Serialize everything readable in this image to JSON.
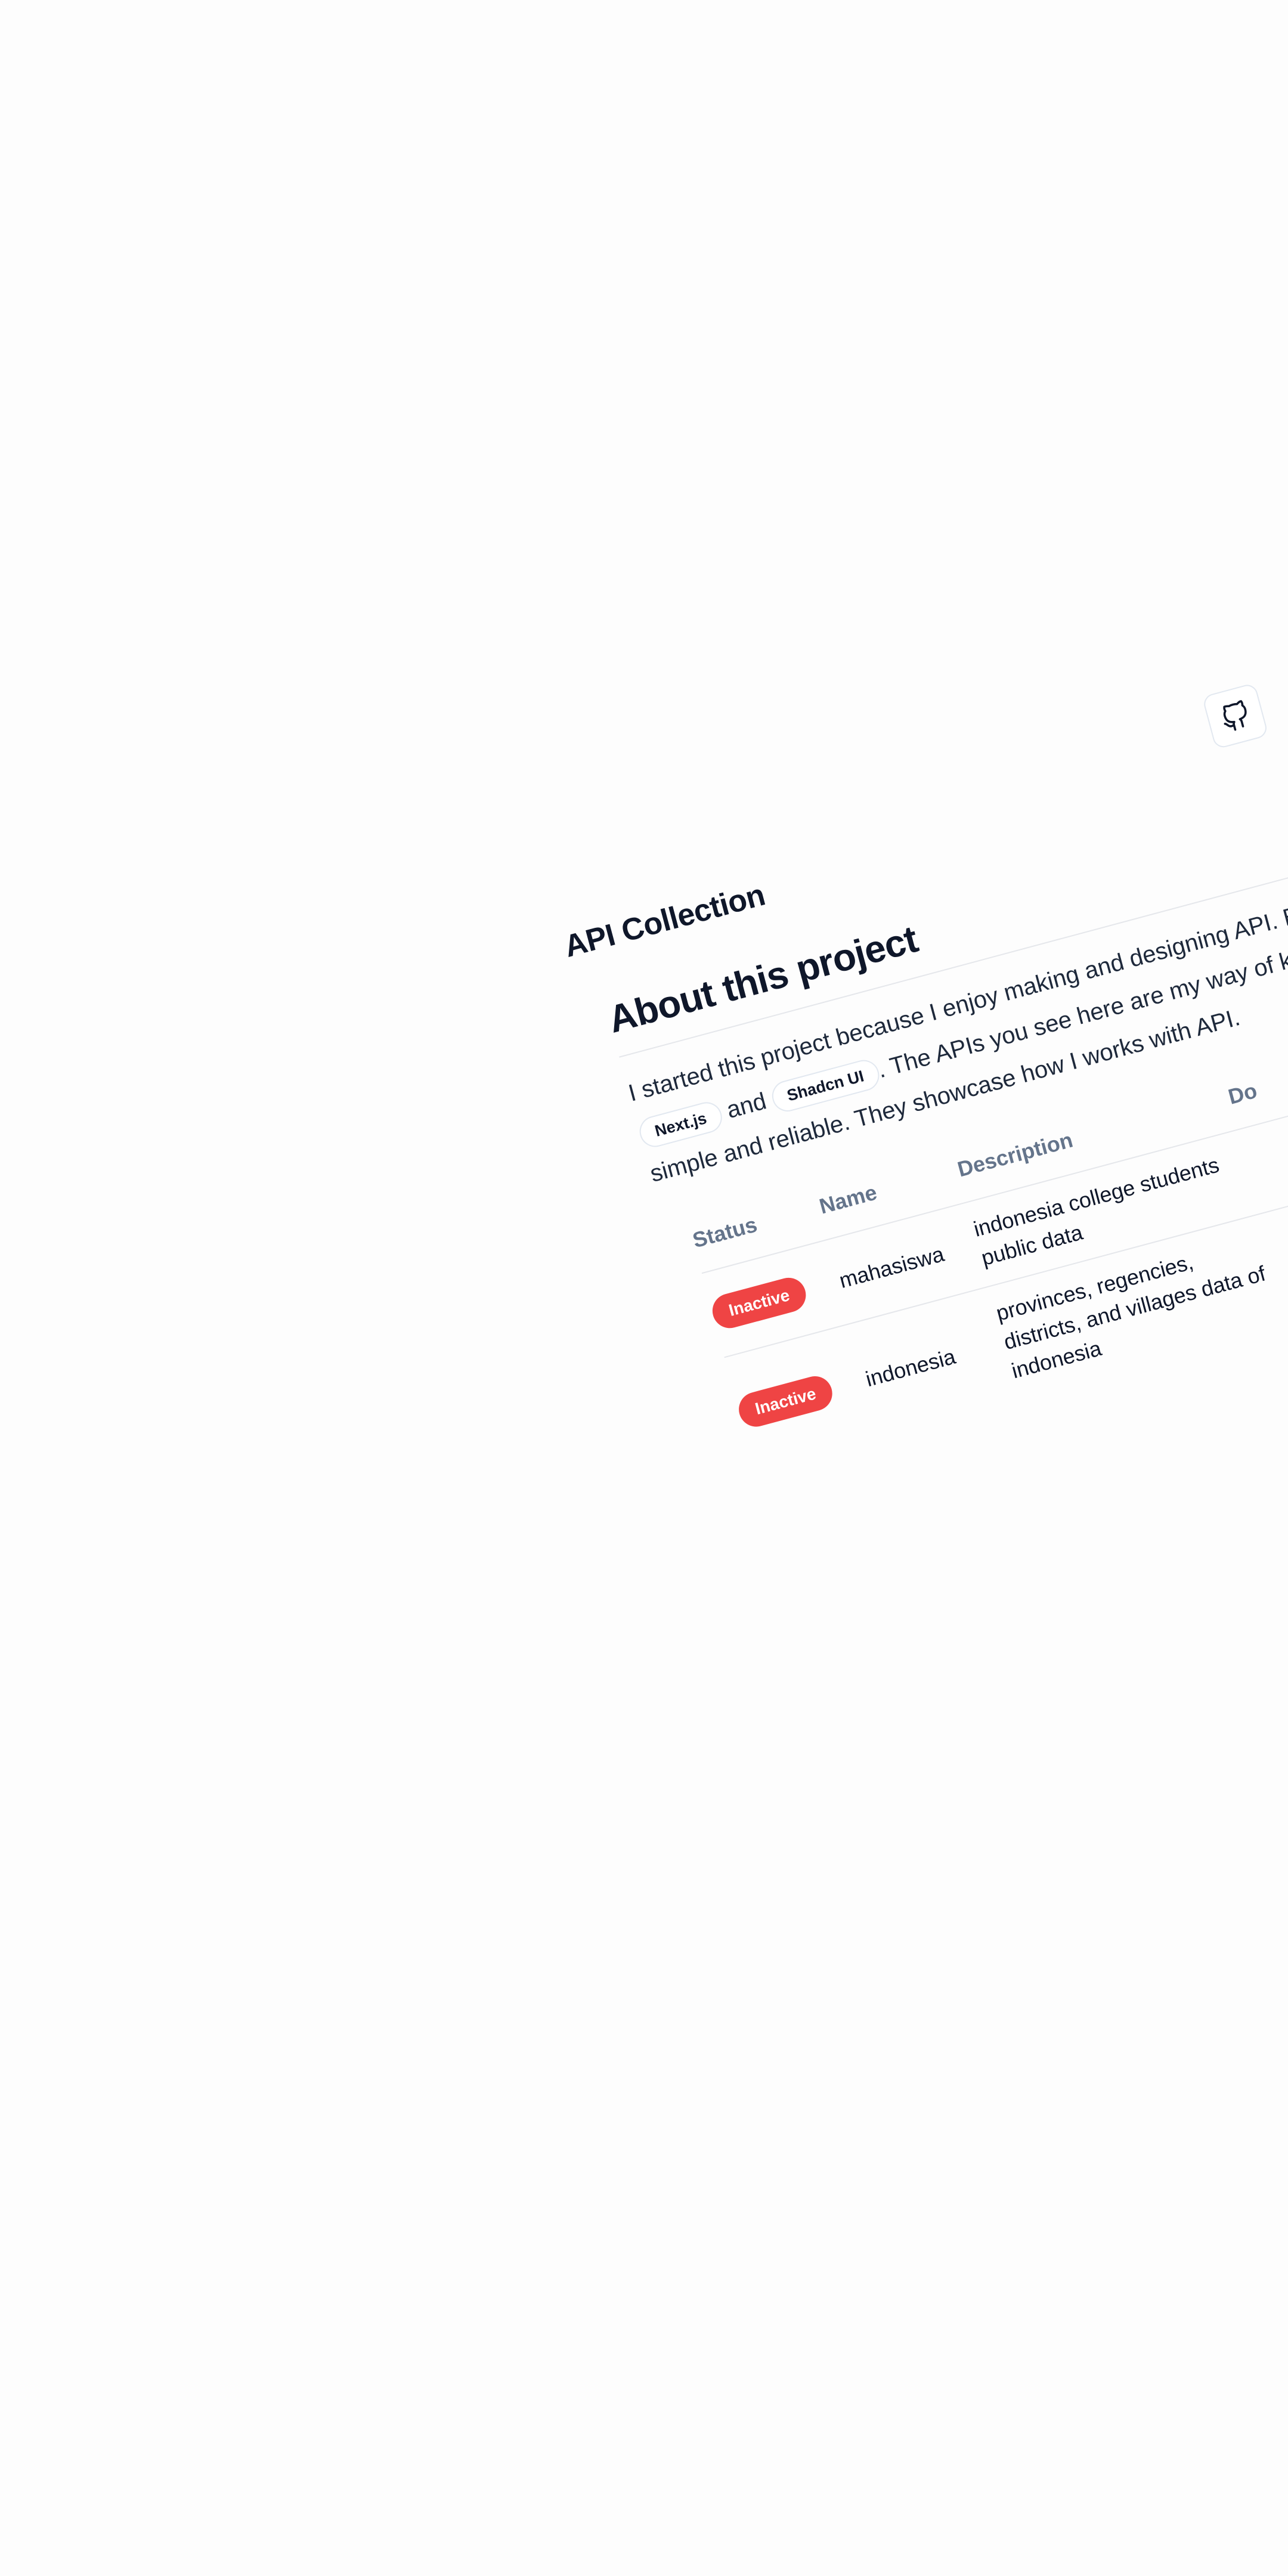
{
  "app": {
    "title": "API Collection"
  },
  "header": {
    "github_icon": "github-icon"
  },
  "about": {
    "title": "About this project",
    "text_part1": "I started this project because I enjoy making and designing API. Bui",
    "text_part2": "and",
    "text_part3": ". The APIs you see here are my way of kee",
    "text_part4": "simple and reliable. They showcase how I works with API.",
    "chips": [
      "Next.js",
      "Shadcn UI"
    ]
  },
  "table": {
    "headers": {
      "status": "Status",
      "name": "Name",
      "description": "Description",
      "docs": "Do"
    },
    "rows": [
      {
        "status": "Inactive",
        "name": "mahasiswa",
        "description": "indonesia college students public data"
      },
      {
        "status": "Inactive",
        "name": "indonesia",
        "description": "provinces, regencies, districts, and villages data of indonesia"
      }
    ]
  },
  "colors": {
    "background": "#fdfdfd",
    "text": "#0f172a",
    "muted": "#64748b",
    "inactive_badge": "#ef4444",
    "border": "#e5e7eb"
  }
}
